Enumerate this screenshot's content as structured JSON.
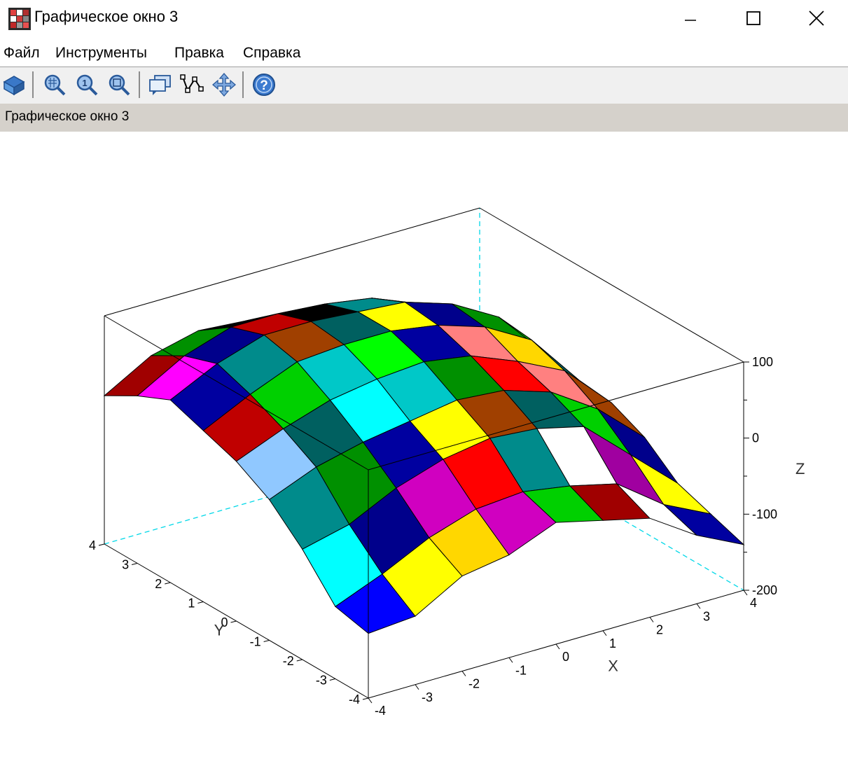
{
  "window": {
    "title": "Графическое окно 3"
  },
  "menu": {
    "items": [
      "Файл",
      "Инструменты",
      "Правка",
      "Справка"
    ]
  },
  "infobar": {
    "text": "Графическое окно 3"
  },
  "chart_data": {
    "type": "surface",
    "x": [
      -4,
      -3,
      -2,
      -1,
      0,
      1,
      2,
      3,
      4
    ],
    "y": [
      -4,
      -3,
      -2,
      -1,
      0,
      1,
      2,
      3,
      4
    ],
    "xlabel": "X",
    "ylabel": "Y",
    "zlabel": "Z",
    "x_ticks": [
      "-4",
      "-3",
      "-2",
      "-1",
      "0",
      "1",
      "2",
      "3",
      "4"
    ],
    "y_ticks": [
      "-4",
      "-3",
      "-2",
      "-1",
      "0",
      "1",
      "2",
      "3",
      "4"
    ],
    "z_ticks": [
      "100",
      "0",
      "-100",
      "-200"
    ],
    "zlim": [
      -200,
      100
    ],
    "z": [
      [
        -115,
        -110,
        -75,
        -65,
        -40,
        -55,
        -70,
        -110,
        -140
      ],
      [
        -105,
        -80,
        -50,
        -30,
        -25,
        -35,
        -50,
        -95,
        -125
      ],
      [
        -55,
        -40,
        -10,
        10,
        20,
        15,
        0,
        -55,
        -110
      ],
      [
        -15,
        10,
        25,
        35,
        45,
        40,
        20,
        -20,
        -75
      ],
      [
        10,
        35,
        55,
        65,
        70,
        60,
        35,
        5,
        -55
      ],
      [
        25,
        55,
        80,
        85,
        85,
        75,
        55,
        20,
        -50
      ],
      [
        40,
        70,
        90,
        90,
        85,
        80,
        60,
        25,
        -40
      ],
      [
        20,
        55,
        75,
        75,
        70,
        60,
        35,
        0,
        -60
      ],
      [
        -5,
        30,
        45,
        40,
        35,
        25,
        5,
        -30,
        -90
      ]
    ]
  }
}
